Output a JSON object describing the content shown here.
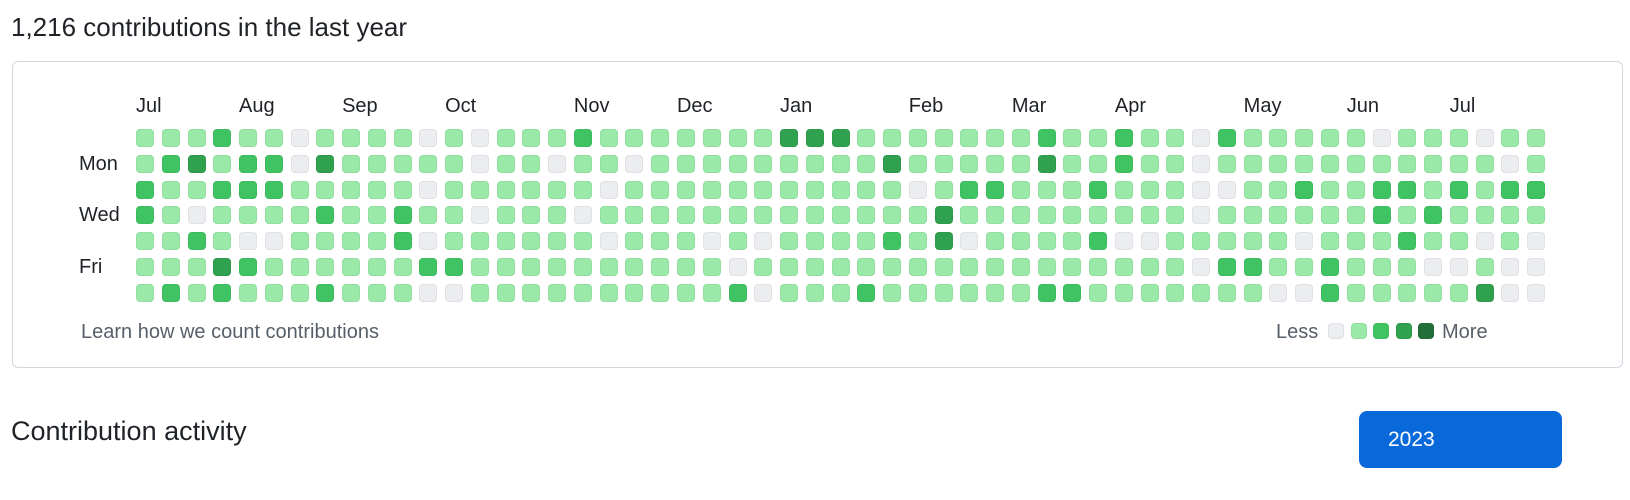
{
  "summary": {
    "heading": "1,216 contributions in the last year"
  },
  "graph": {
    "months": [
      {
        "label": "Jul",
        "col": 0
      },
      {
        "label": "Aug",
        "col": 4
      },
      {
        "label": "Sep",
        "col": 8
      },
      {
        "label": "Oct",
        "col": 12
      },
      {
        "label": "Nov",
        "col": 17
      },
      {
        "label": "Dec",
        "col": 21
      },
      {
        "label": "Jan",
        "col": 25
      },
      {
        "label": "Feb",
        "col": 30
      },
      {
        "label": "Mar",
        "col": 34
      },
      {
        "label": "Apr",
        "col": 38
      },
      {
        "label": "May",
        "col": 43
      },
      {
        "label": "Jun",
        "col": 47
      },
      {
        "label": "Jul",
        "col": 51
      }
    ],
    "day_labels": [
      {
        "label": "Mon",
        "row": 1
      },
      {
        "label": "Wed",
        "row": 3
      },
      {
        "label": "Fri",
        "row": 5
      }
    ],
    "levels": [
      "1112110111101011121111111333111111121121102111110111011",
      "1231220311111011011011111111131111131121101111111111101",
      "2112221111101111110111111111110122111211100112112212122",
      "2101111211211011101111111111111311111111101111112121111",
      "1121001111201111110111010111121301111200111110111211010",
      "1113211111122111111111101111111111111111102211211100100",
      "1212111211100111111111120111211111122111111100211111300"
    ],
    "colors": [
      "#ebedf0",
      "#9be9a8",
      "#40c463",
      "#30a14e",
      "#216e39"
    ],
    "footer_link": "Learn how we count contributions",
    "legend": {
      "less": "Less",
      "more": "More"
    }
  },
  "activity": {
    "title": "Contribution activity",
    "year_button": "2023"
  }
}
